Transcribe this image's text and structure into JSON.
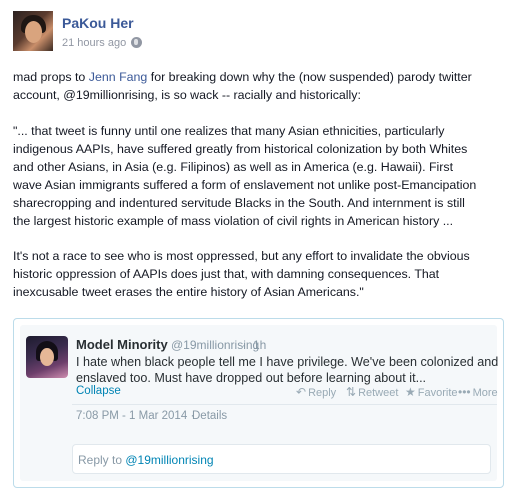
{
  "post": {
    "author": "PaKou Her",
    "time": "21 hours ago",
    "audience_icon": "globe-icon",
    "para1": {
      "before": "mad props to ",
      "mention": "Jenn Fang",
      "after": " for breaking down why the (now suspended) parody twitter",
      "line2": "account, @19millionrising, is so wack -- racially and historically:"
    },
    "quote_lines": [
      "\"... that tweet is funny until one realizes that many Asian ethnicities, particularly",
      "indigenous AAPIs, have suffered greatly from historical colonization by both Whites",
      "and other Asians, in Asia (e.g. Filipinos) as well as in America (e.g. Hawaii). First",
      "wave Asian immigrants suffered a form of enslavement not unlike post-Emancipation",
      "sharecropping and indentured servitude Blacks in the South. And internment is still",
      "the largest historic example of mass violation of civil rights in American history ..."
    ],
    "closing_lines": [
      "It's not a race to see who is most oppressed, but any effort to invalidate the obvious",
      "historic oppression of AAPIs does just that, with damning consequences. That",
      "inexcusable tweet erases the entire history of Asian Americans.\""
    ]
  },
  "tweet": {
    "name": "Model Minority",
    "handle": "@19millionrising",
    "separator": "·",
    "time": "1h",
    "text_lines": [
      "I hate when black people tell me I have privilege. We've been colonized and",
      "enslaved too. Must have dropped out before learning about it..."
    ],
    "collapse_label": "Collapse",
    "actions": {
      "reply": "Reply",
      "retweet": "Retweet",
      "favorite": "Favorite",
      "more": "More"
    },
    "datetime": "7:08 PM - 1 Mar 2014",
    "details_sep": "·",
    "details_label": "Details",
    "reply_prefix": "Reply to ",
    "reply_handle": "@19millionrising"
  },
  "colors": {
    "facebook_link": "#3b5998",
    "twitter_link": "#0084b4",
    "card_border": "#bcdcea"
  }
}
